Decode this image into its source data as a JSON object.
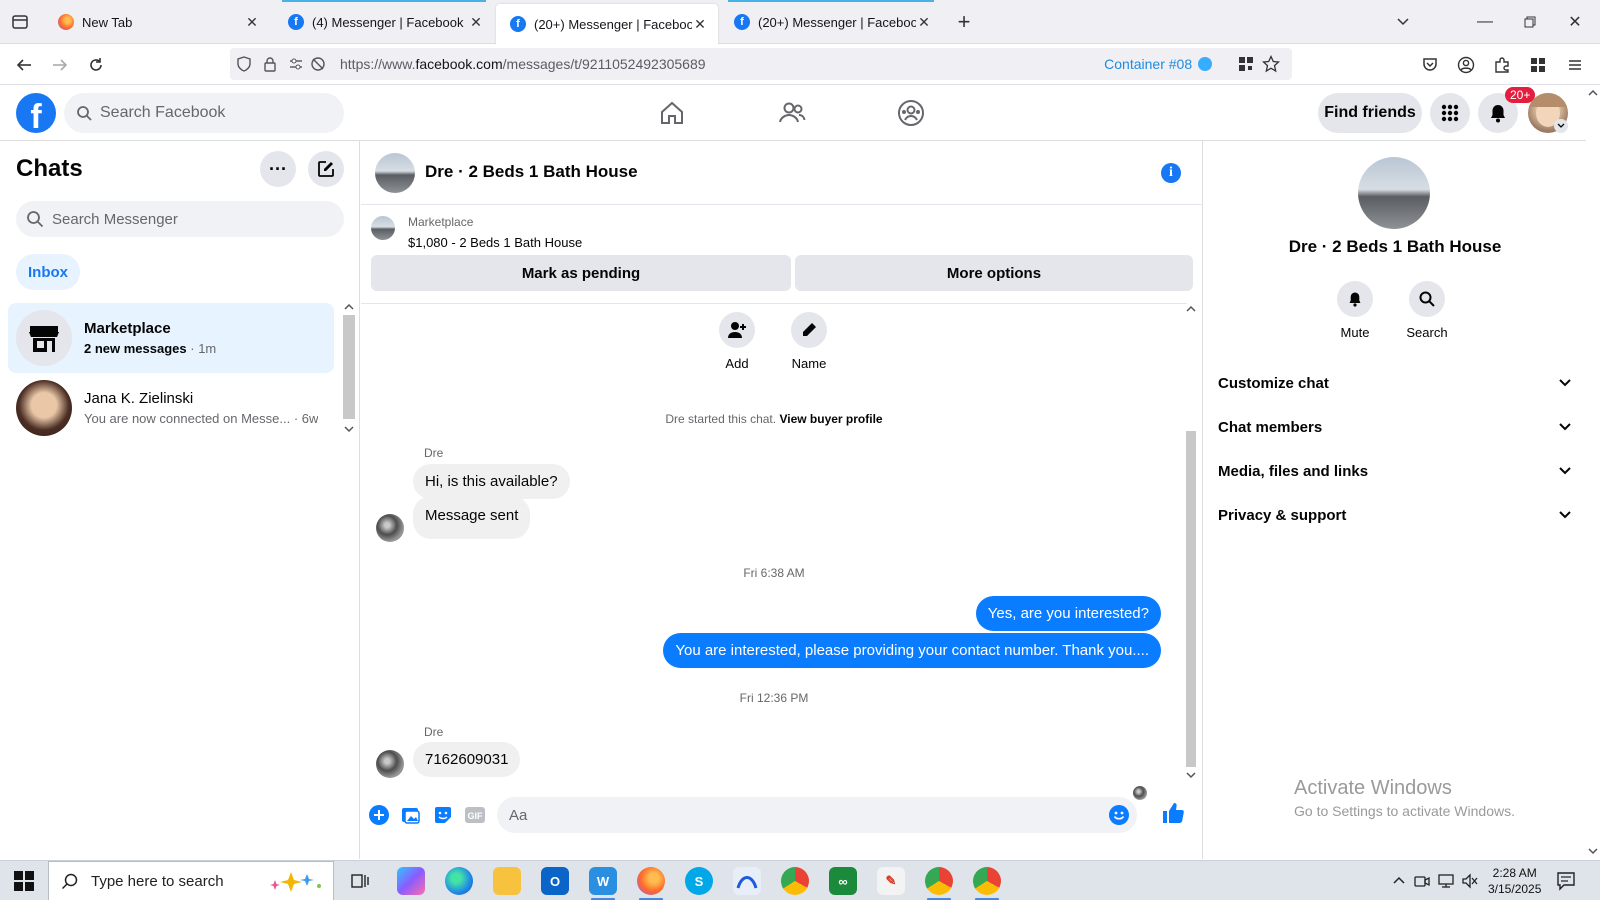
{
  "browser": {
    "tabs": [
      {
        "title": "New Tab",
        "active": false
      },
      {
        "title": "(4) Messenger | Facebook",
        "active": false
      },
      {
        "title": "(20+) Messenger | Facebook",
        "active": true
      },
      {
        "title": "(20+) Messenger | Facebook",
        "active": false
      }
    ],
    "url_prefix": "https://www.",
    "url_domain": "facebook.com",
    "url_path": "/messages/t/9211052492305689",
    "container_label": "Container #08"
  },
  "fb": {
    "logo_letter": "f",
    "search_placeholder": "Search Facebook",
    "find_friends": "Find friends",
    "notif_badge": "20+"
  },
  "sidebar": {
    "title": "Chats",
    "more_label": "···",
    "search_placeholder": "Search Messenger",
    "inbox_label": "Inbox",
    "chats": [
      {
        "name": "Marketplace",
        "preview": "2 new messages",
        "time": "· 1m"
      },
      {
        "name": "Jana K. Zielinski",
        "preview": "You are now connected on Messe...",
        "time": "· 6w"
      }
    ]
  },
  "conversation": {
    "title": "Dre · 2 Beds 1 Bath House",
    "info_glyph": "i",
    "marketplace_label": "Marketplace",
    "listing": "$1,080 - 2 Beds 1 Bath House",
    "mark_pending": "Mark as pending",
    "more_options": "More options",
    "add_label": "Add",
    "name_label": "Name",
    "system_text": "Dre started this chat.",
    "system_link": "View buyer profile",
    "sender1": "Dre",
    "msg1": "Hi, is this available?",
    "msg2": "Message sent",
    "time1": "Fri 6:38 AM",
    "out1": "Yes, are you interested?",
    "out2": "You are interested, please providing your contact number. Thank you....",
    "time2": "Fri 12:36 PM",
    "sender2": "Dre",
    "msg3": "7162609031",
    "composer_placeholder": "Aa"
  },
  "info_panel": {
    "title": "Dre · 2 Beds 1 Bath House",
    "mute": "Mute",
    "search": "Search",
    "sections": [
      "Customize chat",
      "Chat members",
      "Media, files and links",
      "Privacy & support"
    ],
    "activate_title": "Activate Windows",
    "activate_sub": "Go to Settings to activate Windows."
  },
  "taskbar": {
    "search_placeholder": "Type here to search",
    "time": "2:28 AM",
    "date": "3/15/2025"
  },
  "colors": {
    "fb_blue": "#1877f2",
    "bubble_out": "#0a7cff",
    "bubble_in": "#f0f0f0",
    "badge_red": "#e41e3f"
  }
}
